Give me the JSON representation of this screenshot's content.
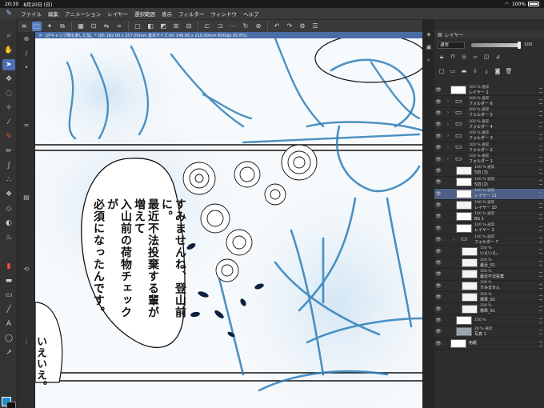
{
  "status": {
    "time": "20:30",
    "date": "8月20日 (日)",
    "battery": "100%"
  },
  "menu": {
    "items": [
      "ファイル",
      "編集",
      "アニメーション",
      "レイヤー",
      "選択範囲",
      "表示",
      "フィルター",
      "ウィンドウ",
      "ヘルプ"
    ]
  },
  "document": {
    "tab_label": "Jがキャンプ場を楽しむ話。* (B5 182.00 x 257.00mm 基本サイズ:A5 148.00 x 210.00mm 600dpi 60.8%)"
  },
  "canvas": {
    "speech_lines": [
      "すみませんね、登山前に。",
      "最近不法投棄する輩が増えて",
      "入山前の荷物チェックが",
      "必須になったんです。"
    ],
    "side_lines": [
      "いえいえ。"
    ]
  },
  "layer_panel": {
    "title": "レイヤー",
    "blend_mode": "通常",
    "opacity": "100",
    "layers": [
      {
        "mode": "100 % 通常",
        "name": "レイヤー 1",
        "kind": "layer",
        "indent": 0
      },
      {
        "mode": "100 % 通常",
        "name": "フォルダー 6",
        "kind": "folder",
        "indent": 0
      },
      {
        "mode": "100 % 通常",
        "name": "フォルダー 5",
        "kind": "folder",
        "indent": 0
      },
      {
        "mode": "100 % 通常",
        "name": "フォルダー 4",
        "kind": "folder",
        "indent": 0
      },
      {
        "mode": "100 % 通常",
        "name": "フォルダー 3",
        "kind": "folder",
        "indent": 0
      },
      {
        "mode": "100 % 通常",
        "name": "フォルダー 2",
        "kind": "folder",
        "indent": 0
      },
      {
        "mode": "100 % 通常",
        "name": "フォルダー 1",
        "kind": "folder",
        "indent": 0
      },
      {
        "mode": "100 % 通常",
        "name": "5切 (3)",
        "kind": "layer",
        "indent": 1
      },
      {
        "mode": "100 % 通常",
        "name": "5切 (2)",
        "kind": "layer",
        "indent": 1
      },
      {
        "mode": "100 % 通常",
        "name": "レイヤー 11",
        "kind": "layer",
        "indent": 1,
        "selected": true
      },
      {
        "mode": "100 % 通常",
        "name": "レイヤー 10",
        "kind": "layer",
        "indent": 1
      },
      {
        "mode": "100 % 通常",
        "name": "BG 1",
        "kind": "layer",
        "indent": 1
      },
      {
        "mode": "100 % 通常",
        "name": "レイヤー 2",
        "kind": "layer",
        "indent": 1
      },
      {
        "mode": "100 % 通常",
        "name": "フォルダー 7",
        "kind": "folder",
        "indent": 1
      },
      {
        "mode": "100 %",
        "name": "いえいえ。",
        "kind": "text",
        "indent": 2
      },
      {
        "mode": "100 %",
        "name": "最近_01",
        "kind": "text",
        "indent": 2
      },
      {
        "mode": "100 %",
        "name": "最近不法投棄",
        "kind": "text",
        "indent": 2
      },
      {
        "mode": "100 %",
        "name": "すみません",
        "kind": "text",
        "indent": 2
      },
      {
        "mode": "100 %",
        "name": "標準_02",
        "kind": "text",
        "indent": 2
      },
      {
        "mode": "100 %",
        "name": "標準_01",
        "kind": "text",
        "indent": 2
      },
      {
        "mode": "100 %",
        "name": "",
        "kind": "layer",
        "indent": 1
      },
      {
        "mode": "28 % 通常",
        "name": "写真 1",
        "kind": "layer",
        "indent": 1
      },
      {
        "mode": "",
        "name": "用紙",
        "kind": "paper",
        "indent": 0
      }
    ]
  }
}
